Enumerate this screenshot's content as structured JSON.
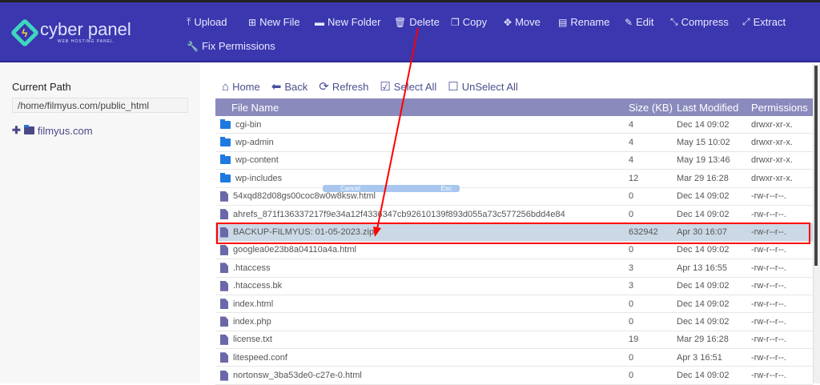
{
  "brand": {
    "name": "cyber panel",
    "tagline": "WEB HOSTING PANEL"
  },
  "toolbar": [
    {
      "label": "Upload",
      "icon": "upload-icon",
      "glyph": "⤒"
    },
    {
      "label": "New File",
      "icon": "plus-square-icon",
      "glyph": "⊞"
    },
    {
      "label": "New Folder",
      "icon": "folder-icon",
      "glyph": "▬"
    },
    {
      "label": "Delete",
      "icon": "trash-icon",
      "glyph": "🗑"
    },
    {
      "label": "Copy",
      "icon": "copy-icon",
      "glyph": "❐"
    },
    {
      "label": "Move",
      "icon": "move-icon",
      "glyph": "✥"
    },
    {
      "label": "Rename",
      "icon": "rename-icon",
      "glyph": "▤"
    },
    {
      "label": "Edit",
      "icon": "edit-icon",
      "glyph": "✎"
    },
    {
      "label": "Compress",
      "icon": "compress-icon",
      "glyph": "⤡"
    },
    {
      "label": "Extract",
      "icon": "extract-icon",
      "glyph": "⤢"
    },
    {
      "label": "Fix Permissions",
      "icon": "wrench-icon",
      "glyph": "🔧"
    }
  ],
  "sidebar": {
    "title": "Current Path",
    "path": "/home/filmyus.com/public_html",
    "tree_item": "filmyus.com"
  },
  "nav": [
    {
      "label": "Home",
      "glyph": "⌂"
    },
    {
      "label": "Back",
      "glyph": "⬅"
    },
    {
      "label": "Refresh",
      "glyph": "⟳"
    },
    {
      "label": "Select All",
      "glyph": "☑"
    },
    {
      "label": "UnSelect All",
      "glyph": "☐"
    }
  ],
  "table": {
    "headers": [
      "File Name",
      "Size (KB)",
      "Last Modified",
      "Permissions"
    ],
    "rows": [
      {
        "name": "cgi-bin",
        "size": "4",
        "modified": "Dec 14 09:02",
        "perm": "drwxr-xr-x.",
        "type": "folder"
      },
      {
        "name": "wp-admin",
        "size": "4",
        "modified": "May 15 10:02",
        "perm": "drwxr-xr-x.",
        "type": "folder"
      },
      {
        "name": "wp-content",
        "size": "4",
        "modified": "May 19 13:46",
        "perm": "drwxr-xr-x.",
        "type": "folder"
      },
      {
        "name": "wp-includes",
        "size": "12",
        "modified": "Mar 29 16:28",
        "perm": "drwxr-xr-x.",
        "type": "folder"
      },
      {
        "name": "54xqd82d08gs00coc8w0w8ksw.html",
        "size": "0",
        "modified": "Dec 14 09:02",
        "perm": "-rw-r--r--.",
        "type": "file"
      },
      {
        "name": "ahrefs_871f136337217f9e34a12f4336347cb92610139f893d055a73c577256bdd4e84",
        "size": "0",
        "modified": "Dec 14 09:02",
        "perm": "-rw-r--r--.",
        "type": "file"
      },
      {
        "name": "BACKUP-FILMYUS: 01-05-2023.zip",
        "size": "632942",
        "modified": "Apr 30 16:07",
        "perm": "-rw-r--r--.",
        "type": "file",
        "selected": true
      },
      {
        "name": "googlea0e23b8a04110a4a.html",
        "size": "0",
        "modified": "Dec 14 09:02",
        "perm": "-rw-r--r--.",
        "type": "file"
      },
      {
        "name": ".htaccess",
        "size": "3",
        "modified": "Apr 13 16:55",
        "perm": "-rw-r--r--.",
        "type": "file"
      },
      {
        "name": ".htaccess.bk",
        "size": "3",
        "modified": "Dec 14 09:02",
        "perm": "-rw-r--r--.",
        "type": "file"
      },
      {
        "name": "index.html",
        "size": "0",
        "modified": "Dec 14 09:02",
        "perm": "-rw-r--r--.",
        "type": "file"
      },
      {
        "name": "index.php",
        "size": "0",
        "modified": "Dec 14 09:02",
        "perm": "-rw-r--r--.",
        "type": "file"
      },
      {
        "name": "license.txt",
        "size": "19",
        "modified": "Mar 29 16:28",
        "perm": "-rw-r--r--.",
        "type": "file"
      },
      {
        "name": "litespeed.conf",
        "size": "0",
        "modified": "Apr 3 16:51",
        "perm": "-rw-r--r--.",
        "type": "file"
      },
      {
        "name": "nortonsw_3ba53de0-c27e-0.html",
        "size": "0",
        "modified": "Dec 14 09:02",
        "perm": "-rw-r--r--.",
        "type": "file"
      }
    ]
  },
  "overlay": {
    "cancel": "Cancel",
    "esc": "Esc"
  },
  "colors": {
    "header": "#3b37ae",
    "table_header": "#8a8abd",
    "selected_row": "#cbd9e6",
    "annotation": "#ff0000"
  }
}
